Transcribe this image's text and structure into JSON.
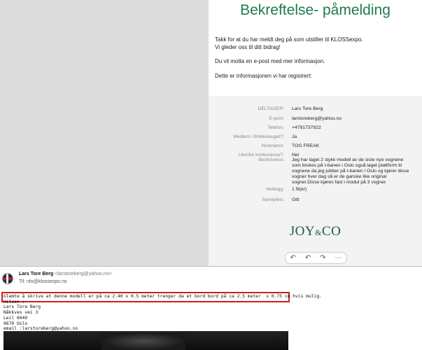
{
  "confirmation": {
    "title": "Bekreftelse- påmelding",
    "intro_line1": "Takk for at du har meldt deg på som utstiller til KLOSSexpo.",
    "intro_line2": "Vi gleder oss til ditt bidrag!",
    "intro_line3": "Du vil motta en e-post med mer informasjon.",
    "intro_line4": "Dette er informasjonen vi har registrert:"
  },
  "details": [
    {
      "label": "DELTAGER:",
      "value": "Lars Tore Berg"
    },
    {
      "label": "E-post:",
      "value": "larstoreberg@yahoo.no"
    },
    {
      "label": "Telefon:",
      "value": "+4791737922"
    },
    {
      "label": "Medlem i Brikkelauget?:",
      "value": "Ja"
    },
    {
      "label": "Nickname:",
      "value": "TOG FREAK"
    },
    {
      "label": "Utenfor konkuranse?:",
      "value": "Nei"
    },
    {
      "label": "Beskrivelse:",
      "value": "Jeg har laget 2 stykk modell av de siste nye vognene\nsom brukes på t-banen i Oslo også laget plattform til\nvognene da jeg jobber på t-banen i Oslo og kjører disse\nvogner hver dag så er de ganske like original\nvogner.Disse kjøres fast i modul på 3 vogner."
    },
    {
      "label": "Vedlegg:",
      "value": "1 fil(er)"
    },
    {
      "label": "Samtykke:",
      "value": "Gitt"
    }
  ],
  "logo": {
    "left": "JOY",
    "amp": "&",
    "right": "CO"
  },
  "toolbar": {
    "icons": [
      "reply-icon",
      "reply-all-icon",
      "forward-icon",
      "more-icon"
    ],
    "glyphs": [
      "↶",
      "↶",
      "↷",
      "⋯"
    ]
  },
  "email": {
    "sender_name": "Lars Tore Berg",
    "sender_addr": "<larstoreberg@yahoo.no>",
    "to_label": "Til:",
    "to_addr": "nfo@klossexpo.no",
    "body_highlight": "Glemte å skrive at denne modell er på ca 2.40 x 0.5 meter trenger da et bord bord på ca 2.5 meter  x 0.75 cm hvis mulig.",
    "body_lines": "Hilsen :\nLars Tore Berg\nNåkkves vei 3\nLeil 6040\n0670 Oslo\nemail :larstoreberg@yahoo.no"
  }
}
